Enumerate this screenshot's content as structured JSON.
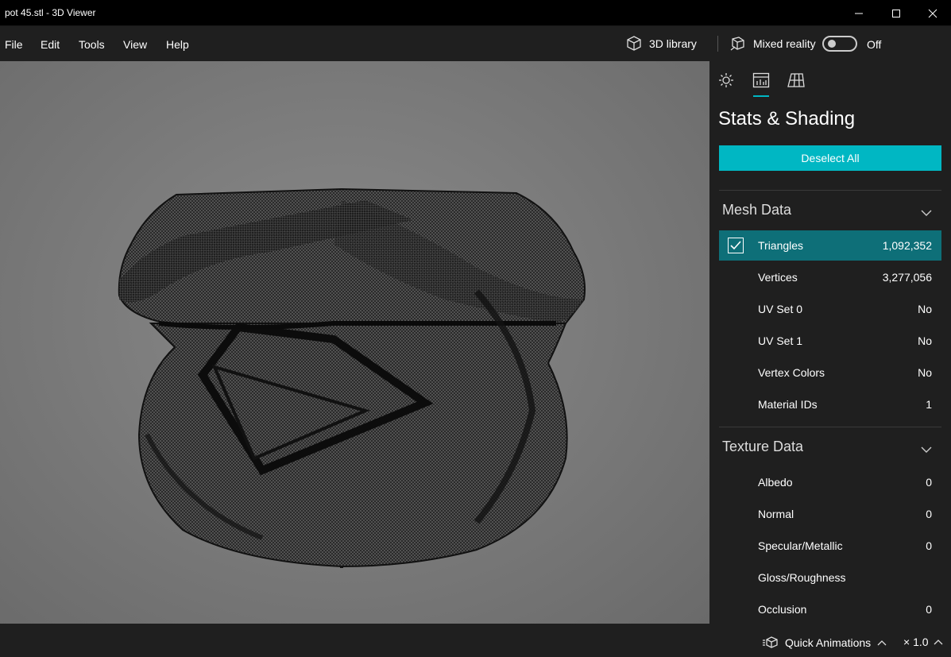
{
  "window": {
    "title": "pot 45.stl - 3D Viewer"
  },
  "menu": {
    "items": [
      "File",
      "Edit",
      "Tools",
      "View",
      "Help"
    ],
    "library_label": "3D library",
    "mixed_reality_label": "Mixed reality",
    "mixed_reality_state": "Off"
  },
  "panel": {
    "title": "Stats & Shading",
    "deselect_label": "Deselect All",
    "mesh_section": "Mesh Data",
    "mesh_rows": [
      {
        "label": "Triangles",
        "value": "1,092,352",
        "checked": true
      },
      {
        "label": "Vertices",
        "value": "3,277,056"
      },
      {
        "label": "UV Set 0",
        "value": "No"
      },
      {
        "label": "UV Set 1",
        "value": "No"
      },
      {
        "label": "Vertex Colors",
        "value": "No"
      },
      {
        "label": "Material IDs",
        "value": "1"
      }
    ],
    "texture_section": "Texture Data",
    "texture_rows": [
      {
        "label": "Albedo",
        "value": "0"
      },
      {
        "label": "Normal",
        "value": "0"
      },
      {
        "label": "Specular/Metallic",
        "value": "0"
      },
      {
        "label": "Gloss/Roughness",
        "value": ""
      },
      {
        "label": "Occlusion",
        "value": "0"
      }
    ]
  },
  "status": {
    "quick_animations": "Quick Animations",
    "speed": "× 1.0"
  },
  "colors": {
    "accent": "#00b7c3",
    "selected_row": "#0e6f78",
    "background": "#1f1f1f"
  }
}
